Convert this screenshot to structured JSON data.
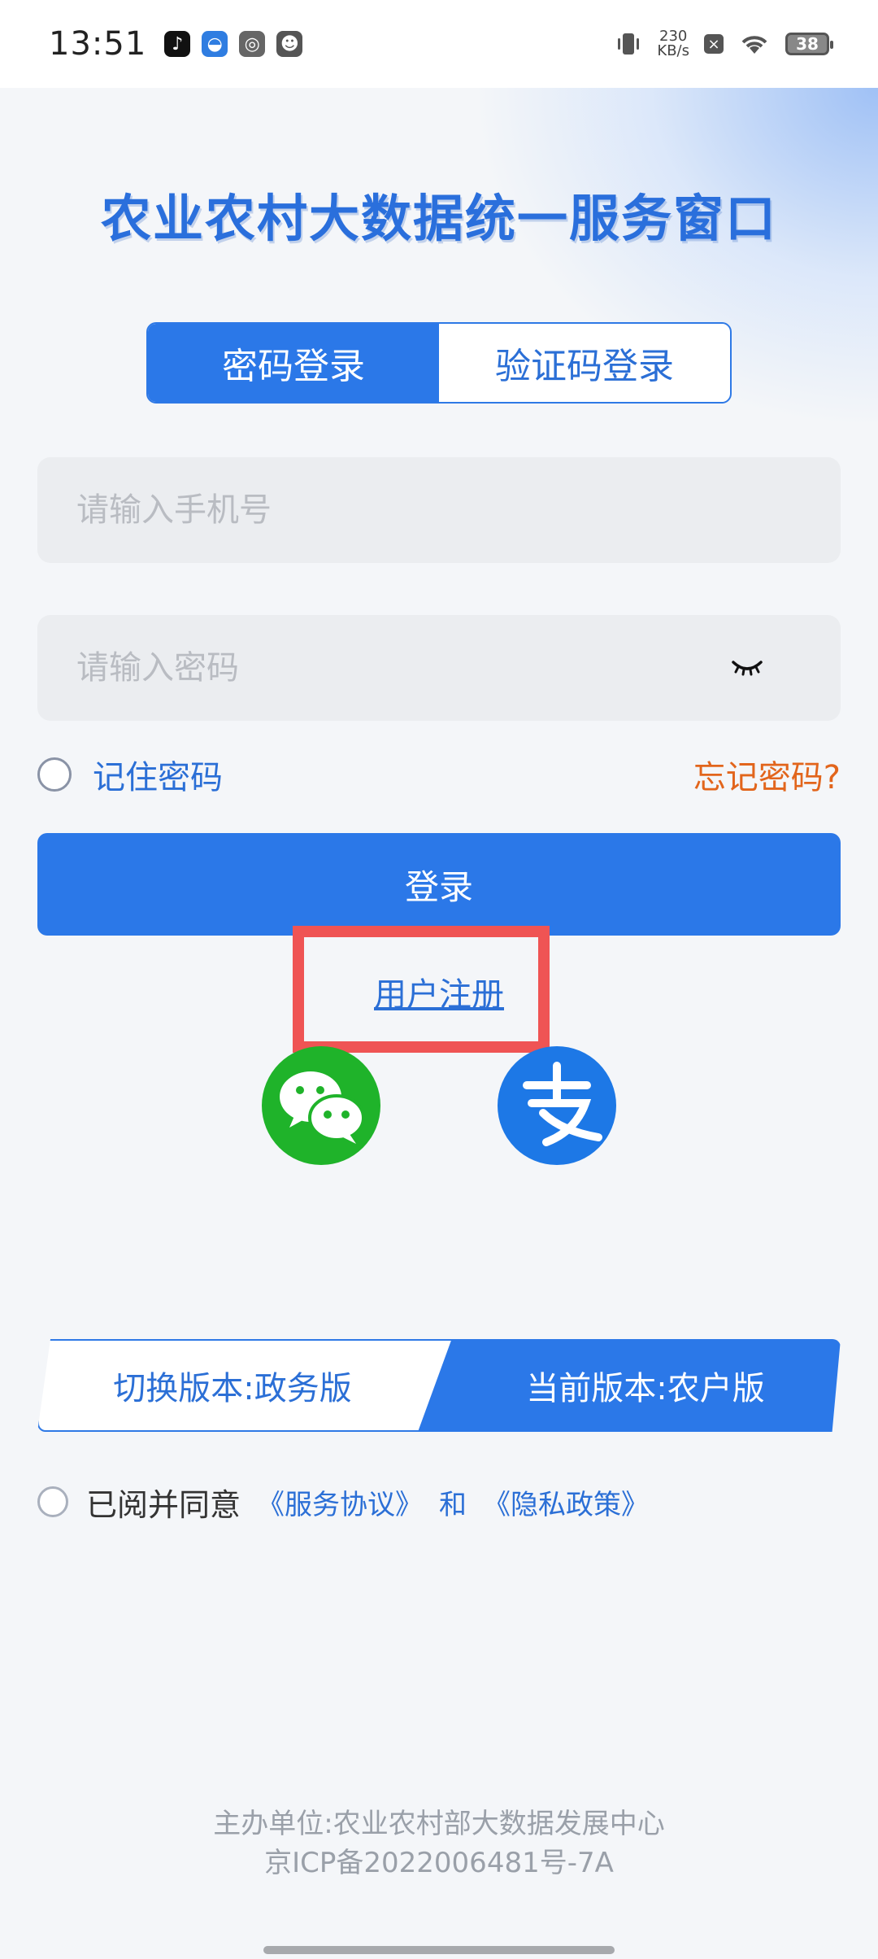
{
  "status_bar": {
    "time": "13:51",
    "net_speed_value": "230",
    "net_speed_unit": "KB/s",
    "battery": "38"
  },
  "app": {
    "title": "农业农村大数据统一服务窗口"
  },
  "login_tabs": [
    {
      "label": "密码登录",
      "active": true
    },
    {
      "label": "验证码登录",
      "active": false
    }
  ],
  "form": {
    "phone_placeholder": "请输入手机号",
    "password_placeholder": "请输入密码",
    "remember_label": "记住密码",
    "forgot_label": "忘记密码?",
    "login_label": "登录",
    "register_label": "用户注册"
  },
  "version": {
    "switch_label": "切换版本:政务版",
    "current_label": "当前版本:农户版"
  },
  "agreement": {
    "prefix": "已阅并同意",
    "service": "《服务协议》",
    "and": "和",
    "privacy": "《隐私政策》"
  },
  "footer": {
    "organizer": "主办单位:农业农村部大数据发展中心",
    "icp": "京ICP备2022006481号-7A"
  },
  "colors": {
    "primary": "#2b78e8",
    "accent": "#e2651c",
    "highlight": "#ef5454",
    "wechat": "#1fb32a",
    "alipay": "#1d78e6"
  },
  "icons": [
    "vibrate-icon",
    "wifi-icon",
    "battery-icon",
    "eye-closed-icon",
    "wechat-icon",
    "alipay-icon"
  ]
}
